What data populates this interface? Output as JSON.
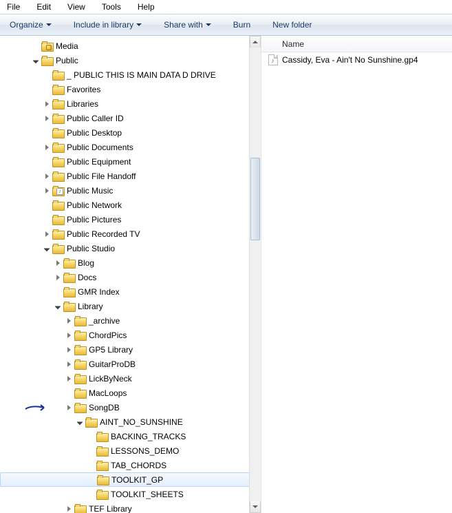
{
  "menu": {
    "file": "File",
    "edit": "Edit",
    "view": "View",
    "tools": "Tools",
    "help": "Help"
  },
  "toolbar": {
    "organize": "Organize",
    "include": "Include in library",
    "share": "Share with",
    "burn": "Burn",
    "newfolder": "New folder"
  },
  "column": {
    "name": "Name"
  },
  "files": [
    {
      "name": "Cassidy, Eva - Ain't No Sunshine.gp4"
    }
  ],
  "tree": [
    {
      "depth": 0,
      "exp": "none",
      "icon": "lock",
      "label": "Media"
    },
    {
      "depth": 0,
      "exp": "open",
      "icon": "folder",
      "label": "Public"
    },
    {
      "depth": 1,
      "exp": "none",
      "icon": "folder",
      "label": "_ PUBLIC THIS IS MAIN DATA D DRIVE"
    },
    {
      "depth": 1,
      "exp": "none",
      "icon": "folder",
      "label": "Favorites"
    },
    {
      "depth": 1,
      "exp": "closed",
      "icon": "folder",
      "label": "Libraries"
    },
    {
      "depth": 1,
      "exp": "closed",
      "icon": "folder",
      "label": "Public Caller ID"
    },
    {
      "depth": 1,
      "exp": "none",
      "icon": "folder",
      "label": "Public Desktop"
    },
    {
      "depth": 1,
      "exp": "closed",
      "icon": "folder",
      "label": "Public Documents"
    },
    {
      "depth": 1,
      "exp": "none",
      "icon": "folder",
      "label": "Public Equipment"
    },
    {
      "depth": 1,
      "exp": "closed",
      "icon": "folder",
      "label": "Public File Handoff"
    },
    {
      "depth": 1,
      "exp": "closed",
      "icon": "music",
      "label": "Public Music"
    },
    {
      "depth": 1,
      "exp": "none",
      "icon": "folder",
      "label": "Public Network"
    },
    {
      "depth": 1,
      "exp": "none",
      "icon": "folder",
      "label": "Public Pictures"
    },
    {
      "depth": 1,
      "exp": "closed",
      "icon": "folder",
      "label": "Public Recorded TV"
    },
    {
      "depth": 1,
      "exp": "open",
      "icon": "folder",
      "label": "Public Studio"
    },
    {
      "depth": 2,
      "exp": "closed",
      "icon": "folder",
      "label": "Blog"
    },
    {
      "depth": 2,
      "exp": "closed",
      "icon": "folder",
      "label": "Docs"
    },
    {
      "depth": 2,
      "exp": "none",
      "icon": "folder",
      "label": "GMR Index"
    },
    {
      "depth": 2,
      "exp": "open",
      "icon": "folder",
      "label": "Library"
    },
    {
      "depth": 3,
      "exp": "closed",
      "icon": "folder",
      "label": "_archive"
    },
    {
      "depth": 3,
      "exp": "closed",
      "icon": "folder",
      "label": "ChordPics"
    },
    {
      "depth": 3,
      "exp": "closed",
      "icon": "folder",
      "label": "GP5 Library"
    },
    {
      "depth": 3,
      "exp": "closed",
      "icon": "folder",
      "label": "GuitarProDB"
    },
    {
      "depth": 3,
      "exp": "closed",
      "icon": "folder",
      "label": "LickByNeck"
    },
    {
      "depth": 3,
      "exp": "none",
      "icon": "folder",
      "label": "MacLoops"
    },
    {
      "depth": 3,
      "exp": "closed",
      "icon": "folder",
      "label": "SongDB",
      "arrow": true
    },
    {
      "depth": 4,
      "exp": "open",
      "icon": "folder",
      "label": "AINT_NO_SUNSHINE"
    },
    {
      "depth": 5,
      "exp": "none",
      "icon": "folder",
      "label": "BACKING_TRACKS"
    },
    {
      "depth": 5,
      "exp": "none",
      "icon": "folder",
      "label": "LESSONS_DEMO"
    },
    {
      "depth": 5,
      "exp": "none",
      "icon": "folder",
      "label": "TAB_CHORDS"
    },
    {
      "depth": 5,
      "exp": "none",
      "icon": "folder",
      "label": "TOOLKIT_GP",
      "selected": true
    },
    {
      "depth": 5,
      "exp": "none",
      "icon": "folder",
      "label": "TOOLKIT_SHEETS"
    },
    {
      "depth": 3,
      "exp": "closed",
      "icon": "folder",
      "label": "TEF Library"
    }
  ]
}
